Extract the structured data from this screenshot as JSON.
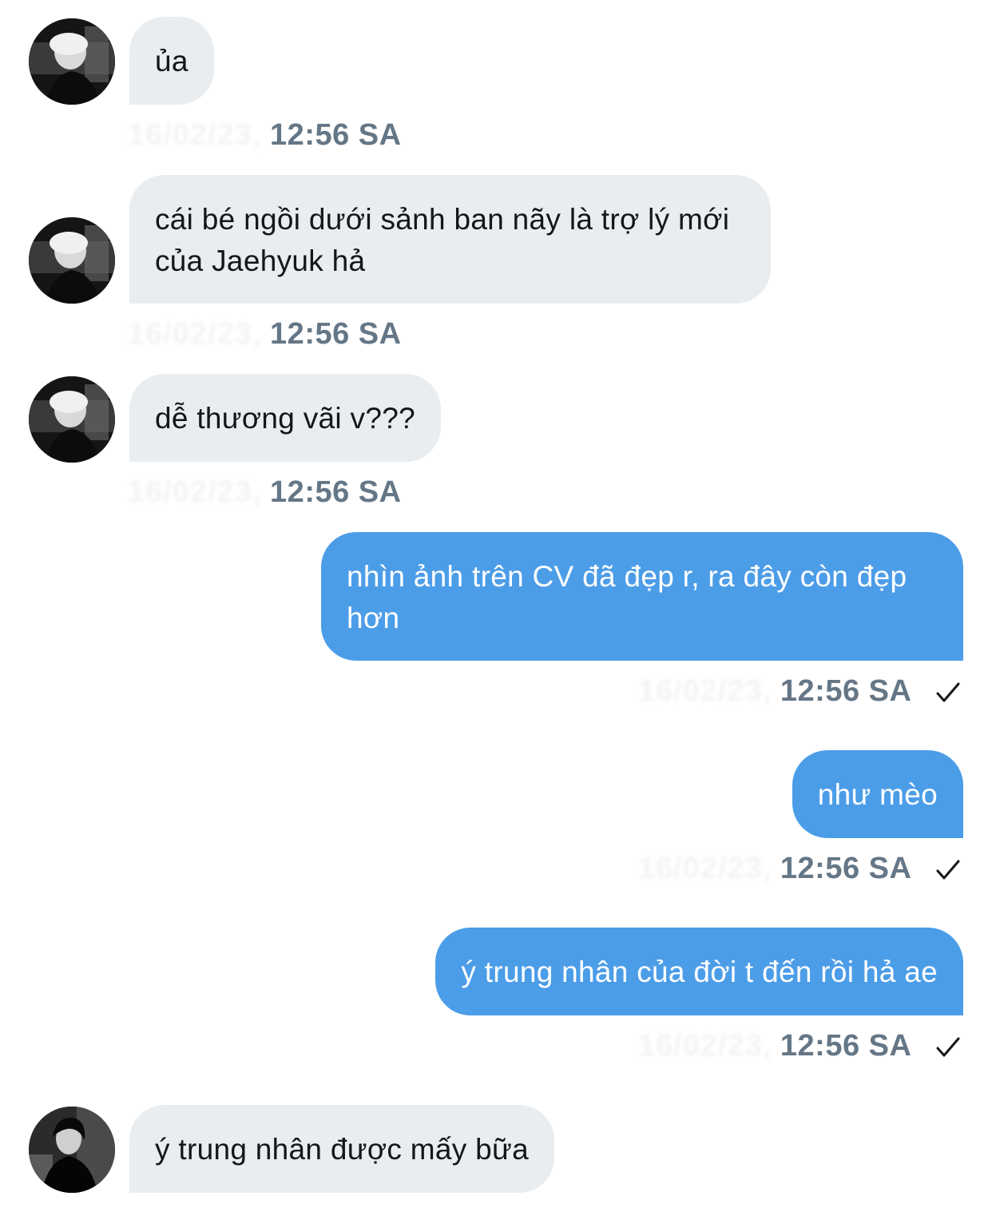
{
  "messages": [
    {
      "direction": "in",
      "text": "ủa",
      "date": "16/02/23,",
      "time": "12:56 SA",
      "avatar": "avatar-blond"
    },
    {
      "direction": "in",
      "text": "cái bé ngồi dưới sảnh ban nãy là trợ lý mới của Jaehyuk hả",
      "date": "16/02/23,",
      "time": "12:56 SA",
      "avatar": "avatar-blond"
    },
    {
      "direction": "in",
      "text": "dễ thương vãi v???",
      "date": "16/02/23,",
      "time": "12:56 SA",
      "avatar": "avatar-blond"
    },
    {
      "direction": "out",
      "text": "nhìn ảnh trên CV đã đẹp r, ra đây còn đẹp hơn",
      "date": "16/02/23,",
      "time": "12:56 SA",
      "status_icon": "check-icon"
    },
    {
      "direction": "out",
      "text": "như mèo",
      "date": "16/02/23,",
      "time": "12:56 SA",
      "status_icon": "check-icon"
    },
    {
      "direction": "out",
      "text": "ý trung nhân của đời t đến rồi hả ae",
      "date": "16/02/23,",
      "time": "12:56 SA",
      "status_icon": "check-icon"
    },
    {
      "direction": "in",
      "text": "ý trung nhân được mấy bữa",
      "avatar": "avatar-dark-hair"
    }
  ],
  "colors": {
    "incoming_bubble": "#e9edf0",
    "outgoing_bubble": "#4c9de8",
    "timestamp": "#657786",
    "incoming_text": "#14171a",
    "outgoing_text": "#ffffff"
  }
}
